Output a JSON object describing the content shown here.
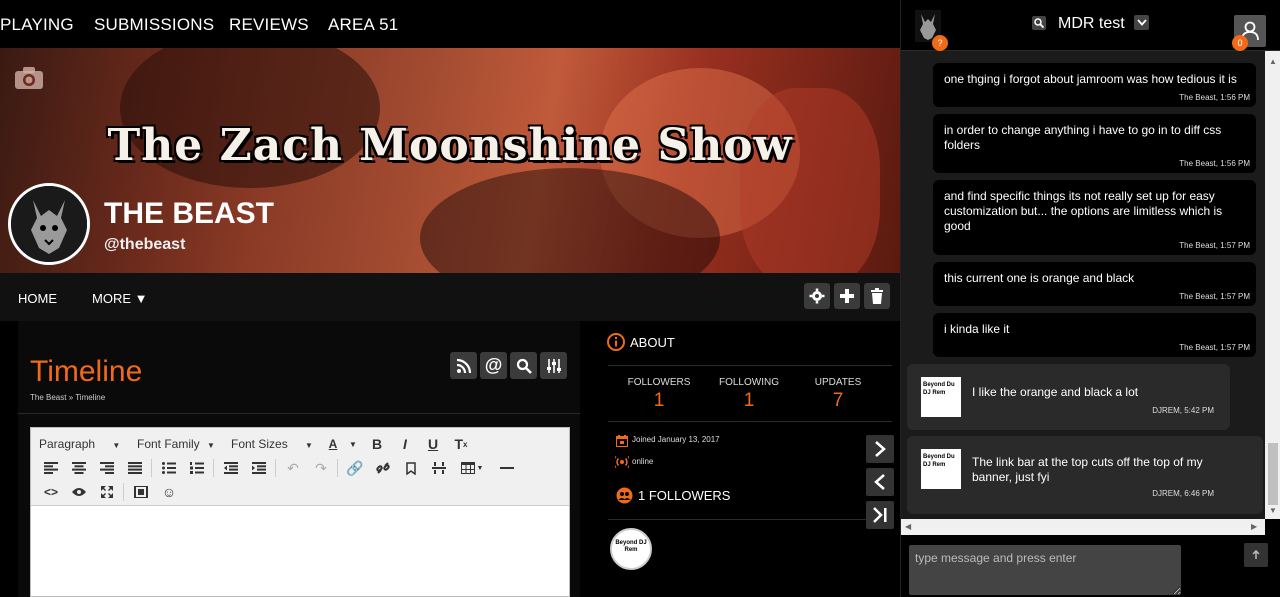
{
  "topnav": {
    "items": [
      "PLAYING",
      "SUBMISSIONS",
      "REVIEWS",
      "AREA 51"
    ]
  },
  "banner": {
    "title": "The Zach Moonshine Show",
    "profile_name": "THE BEAST",
    "profile_handle": "@thebeast"
  },
  "profile_menu": {
    "home": "HOME",
    "more": "MORE ▼"
  },
  "timeline": {
    "title": "Timeline",
    "breadcrumb": "The Beast » Timeline"
  },
  "editor": {
    "paragraph": "Paragraph",
    "font_family": "Font Family",
    "font_sizes": "Font Sizes"
  },
  "about": {
    "heading": "ABOUT",
    "stats": [
      {
        "label": "FOLLOWERS",
        "value": "1"
      },
      {
        "label": "FOLLOWING",
        "value": "1"
      },
      {
        "label": "UPDATES",
        "value": "7"
      }
    ],
    "joined": "Joined January 13, 2017",
    "status": "online",
    "followers_heading": "1 FOLLOWERS",
    "follower_avatar_text": "Beyond DJ Rem"
  },
  "chat": {
    "room": "MDR test",
    "badge_left": "?",
    "badge_right": "0",
    "messages": [
      {
        "text": "one thging i forgot about jamroom was how tedious it is",
        "meta": "The Beast, 1:56 PM"
      },
      {
        "text": "in order to change anything i have to go in to diff css folders",
        "meta": "The Beast, 1:56 PM"
      },
      {
        "text": "and find specific things its not really set up for easy customization but... the options are limitless which is good",
        "meta": "The Beast, 1:57 PM"
      },
      {
        "text": "this current one is orange and black",
        "meta": "The Beast, 1:57 PM"
      },
      {
        "text": "i kinda like it",
        "meta": "The Beast, 1:57 PM"
      }
    ],
    "others": [
      {
        "text": "I like the orange and black a lot",
        "meta": "DJREM, 5:42 PM",
        "avatar": "Beyond Du DJ Rem"
      },
      {
        "text": "The link bar at the top cuts off the top of my banner, just fyi",
        "meta": "DJREM, 6:46 PM",
        "avatar": "Beyond Du DJ Rem"
      }
    ],
    "input_placeholder": "type message and press enter"
  },
  "colors": {
    "accent": "#f06a1a",
    "background": "#000000",
    "panel": "#111111"
  }
}
